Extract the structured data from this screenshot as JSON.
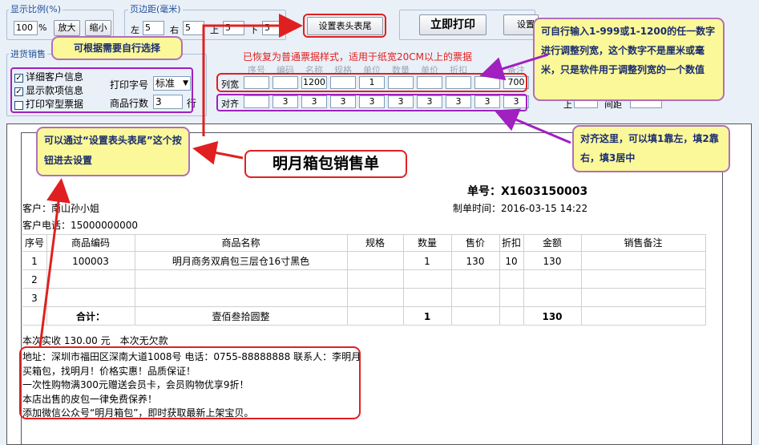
{
  "zoom": {
    "title": "显示比例(%)",
    "value": "100",
    "unit": "%",
    "zoom_in": "放大",
    "zoom_out": "缩小"
  },
  "margin": {
    "title": "页边距(毫米)",
    "left_label": "左",
    "left": "5",
    "right_label": "右",
    "right": "5",
    "top_label": "上",
    "top": "5",
    "bottom_label": "下",
    "bottom": "5"
  },
  "buttons": {
    "header_footer": "设置表头表尾",
    "print_now": "立即打印",
    "settings_partial": "设置"
  },
  "options": {
    "title": "进货销售",
    "detail_customer": "详细客户信息",
    "show_items": "显示款项信息",
    "print_card_ticket": "打印窄型票据",
    "font_label": "打印字号",
    "font_value": "标准",
    "rows_label": "商品行数",
    "rows_value": "3",
    "rows_unit": "行"
  },
  "restore_hint": "已恢复为普通票据样式，适用于纸宽20CM以上的票据",
  "col_headers": [
    "序号",
    "编码",
    "名称",
    "规格",
    "单位",
    "数量",
    "单价",
    "折扣",
    "",
    "备注"
  ],
  "col_width_label": "列宽",
  "col_widths": [
    "",
    "",
    "1200",
    "",
    "1",
    "",
    "",
    "",
    "",
    "700"
  ],
  "align_label": "对齐",
  "aligns": [
    "",
    "3",
    "3",
    "3",
    "3",
    "3",
    "3",
    "3",
    "3",
    "3"
  ],
  "right_partial": {
    "a": "上",
    "b": "间",
    "b_suffix": "距"
  },
  "callouts": {
    "select": "可根据需要自行选择",
    "width": "可自行输入1-999或1-1200的任一数字进行调整列宽，这个数字不是厘米或毫米，只是软件用于调整列宽的一个数值",
    "header": "可以通过“设置表头表尾”这个按钮进去设置",
    "title": "明月箱包销售单",
    "align": "对齐这里，可以填1靠左，填2靠右，填3居中"
  },
  "receipt": {
    "order_no": "单号：X1603150003",
    "customer": "客户：南山孙小姐",
    "date": "制单时间：2016-03-15 14:22",
    "phone": "客户电话：15000000000",
    "headers": [
      "序号",
      "商品编码",
      "商品名称",
      "规格",
      "数量",
      "售价",
      "折扣",
      "金额",
      "销售备注"
    ],
    "rows": [
      {
        "no": "1",
        "code": "100003",
        "name": "明月商务双肩包三层仓16寸黑色",
        "spec": "",
        "qty": "1",
        "price": "130",
        "discount": "10",
        "amount": "130",
        "note": ""
      },
      {
        "no": "2",
        "code": "",
        "name": "",
        "spec": "",
        "qty": "",
        "price": "",
        "discount": "",
        "amount": "",
        "note": ""
      },
      {
        "no": "3",
        "code": "",
        "name": "",
        "spec": "",
        "qty": "",
        "price": "",
        "discount": "",
        "amount": "",
        "note": ""
      }
    ],
    "total_label": "合计：",
    "total_words": "壹佰叁拾圆整",
    "total_qty": "1",
    "total_amount": "130",
    "paid": "本次实收 130.00 元　本次无欠款",
    "footer_lines": [
      "地址：深圳市福田区深南大道1008号 电话：0755-88888888 联系人：李明月",
      "买箱包，找明月！价格实惠！品质保证！",
      "一次性购物满300元赠送会员卡，会员购物优享9折！",
      "本店出售的皮包一律免费保养！",
      "添加微信公众号“明月箱包”，即时获取最新上架宝贝。"
    ]
  },
  "colors": {
    "accent_red": "#e02020",
    "callout_border": "#b06fb9",
    "callout_bg": "#fbf89a",
    "hint_red": "#e02020"
  }
}
